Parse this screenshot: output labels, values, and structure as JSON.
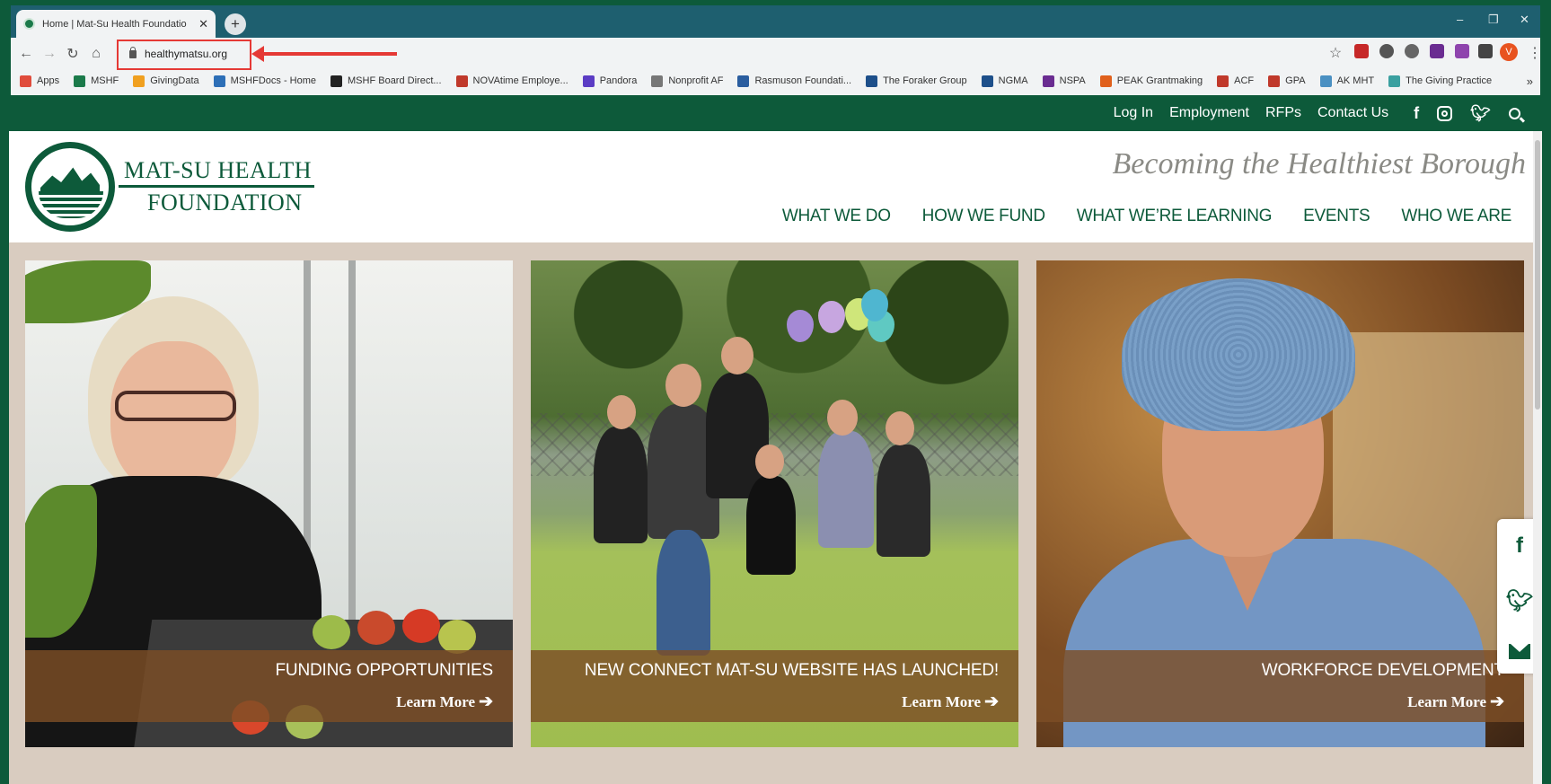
{
  "browser": {
    "tab_title": "Home | Mat-Su Health Foundatio",
    "tab_close": "✕",
    "new_tab": "+",
    "url": "healthymatsu.org",
    "profile_initial": "V",
    "window_controls": [
      "–",
      "❐",
      "✕"
    ],
    "bookmarks": [
      {
        "label": "Apps",
        "color": "#e04c3c"
      },
      {
        "label": "MSHF",
        "color": "#1b7a4a"
      },
      {
        "label": "GivingData",
        "color": "#f0a020"
      },
      {
        "label": "MSHFDocs - Home",
        "color": "#2d6fb7"
      },
      {
        "label": "MSHF Board Direct...",
        "color": "#222222"
      },
      {
        "label": "NOVAtime Employe...",
        "color": "#c0392b"
      },
      {
        "label": "Pandora",
        "color": "#5b3cc4"
      },
      {
        "label": "Nonprofit AF",
        "color": "#777777"
      },
      {
        "label": "Rasmuson Foundati...",
        "color": "#2a5d9f"
      },
      {
        "label": "The Foraker Group",
        "color": "#1d4f8a"
      },
      {
        "label": "NGMA",
        "color": "#1d4f8a"
      },
      {
        "label": "NSPA",
        "color": "#6a2c91"
      },
      {
        "label": "PEAK Grantmaking",
        "color": "#e0601c"
      },
      {
        "label": "ACF",
        "color": "#c0392b"
      },
      {
        "label": "GPA",
        "color": "#c0392b"
      },
      {
        "label": "AK MHT",
        "color": "#4a90c2"
      },
      {
        "label": "The Giving Practice",
        "color": "#3aa0a0"
      }
    ]
  },
  "site": {
    "topbar": {
      "links": [
        "Log In",
        "Employment",
        "RFPs",
        "Contact Us"
      ]
    },
    "logo": {
      "line1": "MAT-SU HEALTH",
      "line2": "FOUNDATION"
    },
    "tagline": "Becoming the Healthiest Borough",
    "nav": [
      "WHAT WE DO",
      "HOW WE FUND",
      "WHAT WE’RE LEARNING",
      "EVENTS",
      "WHO WE ARE"
    ],
    "cards": [
      {
        "title": "FUNDING OPPORTUNITIES",
        "more": "Learn More"
      },
      {
        "title": "NEW CONNECT MAT-SU WEBSITE HAS LAUNCHED!",
        "more": "Learn More"
      },
      {
        "title": "WORKFORCE DEVELOPMENT",
        "more": "Learn More"
      }
    ],
    "colors": {
      "brand_green": "#0d5a3a",
      "caption_brown": "#7c4e26",
      "hero_bg": "#d9ccc0"
    }
  }
}
